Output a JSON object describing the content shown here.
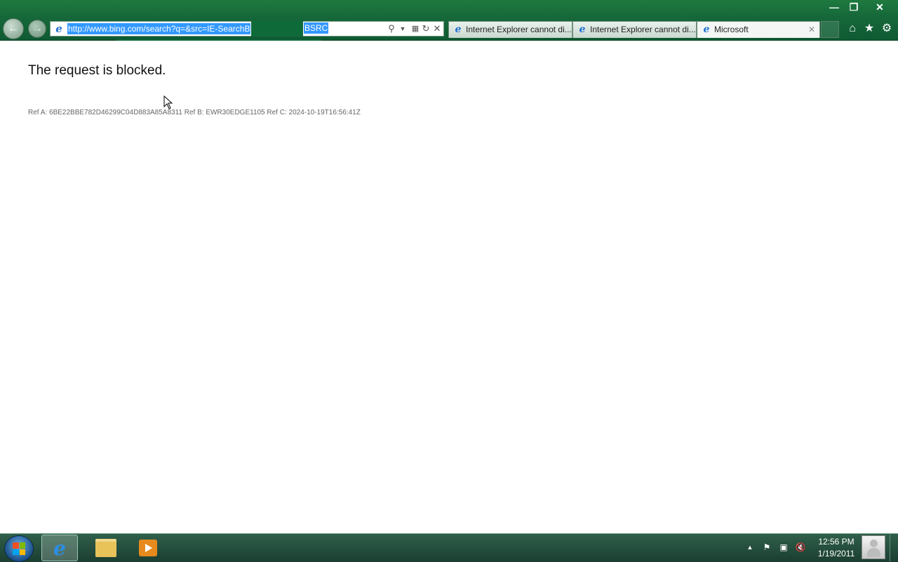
{
  "window": {
    "minimize_glyph": "—",
    "maximize_glyph": "❐",
    "close_glyph": "✕"
  },
  "address_bar": {
    "url_visible_start": "http://www.bing.com/search?q=&src=IE-SearchB",
    "url_visible_end": "BSRC"
  },
  "tabs": [
    {
      "label": "Internet Explorer cannot di..."
    },
    {
      "label": "Internet Explorer cannot di..."
    },
    {
      "label": "Microsoft",
      "active": true
    }
  ],
  "page": {
    "heading": "The request is blocked.",
    "ref_line": "Ref A: 6BE22BBE782D46299C04D883A85A8311 Ref B: EWR30EDGE1105 Ref C: 2024-10-19T16:56:41Z"
  },
  "taskbar": {
    "clock_time": "12:56 PM",
    "clock_date": "1/19/2011"
  },
  "colors": {
    "chrome_green": "#16693a",
    "selection_blue": "#3399ff",
    "taskbar_green": "#1b3e31"
  },
  "icons": [
    "back-icon",
    "forward-icon",
    "ie-icon",
    "search-icon",
    "dropdown-icon",
    "compatibility-icon",
    "refresh-icon",
    "stop-icon",
    "home-icon",
    "favorites-icon",
    "tools-icon",
    "start-icon",
    "folder-icon",
    "media-player-icon",
    "flag-icon",
    "network-icon",
    "volume-muted-icon",
    "user-icon"
  ]
}
